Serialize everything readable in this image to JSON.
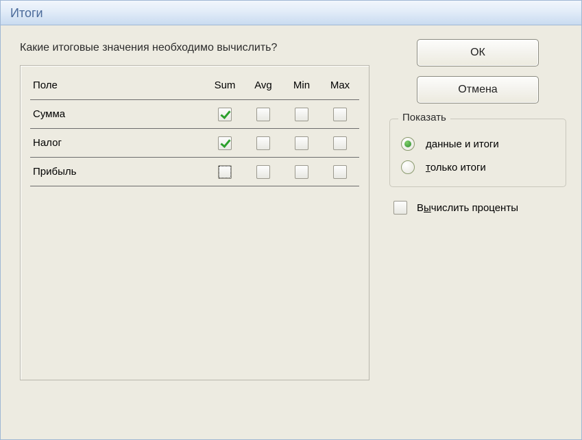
{
  "title": "Итоги",
  "question": "Какие итоговые значения необходимо вычислить?",
  "headers": {
    "field": "Поле",
    "sum": "Sum",
    "avg": "Avg",
    "min": "Min",
    "max": "Max"
  },
  "rows": [
    {
      "field": "Сумма",
      "sum": true,
      "avg": false,
      "min": false,
      "max": false
    },
    {
      "field": "Налог",
      "sum": true,
      "avg": false,
      "min": false,
      "max": false
    },
    {
      "field": "Прибыль",
      "sum": false,
      "avg": false,
      "min": false,
      "max": false,
      "focusedSum": true
    }
  ],
  "buttons": {
    "ok": "ОК",
    "cancel": "Отмена"
  },
  "showGroup": {
    "title": "Показать",
    "opt_data_and_totals_prefix": "д",
    "opt_data_and_totals_rest": "анные и итоги",
    "opt_totals_only_prefix": "т",
    "opt_totals_only_rest": "олько итоги",
    "selected": "data_and_totals"
  },
  "calcPercents": {
    "prefix": "В",
    "mnemonic": "ы",
    "rest": "числить проценты",
    "checked": false
  }
}
